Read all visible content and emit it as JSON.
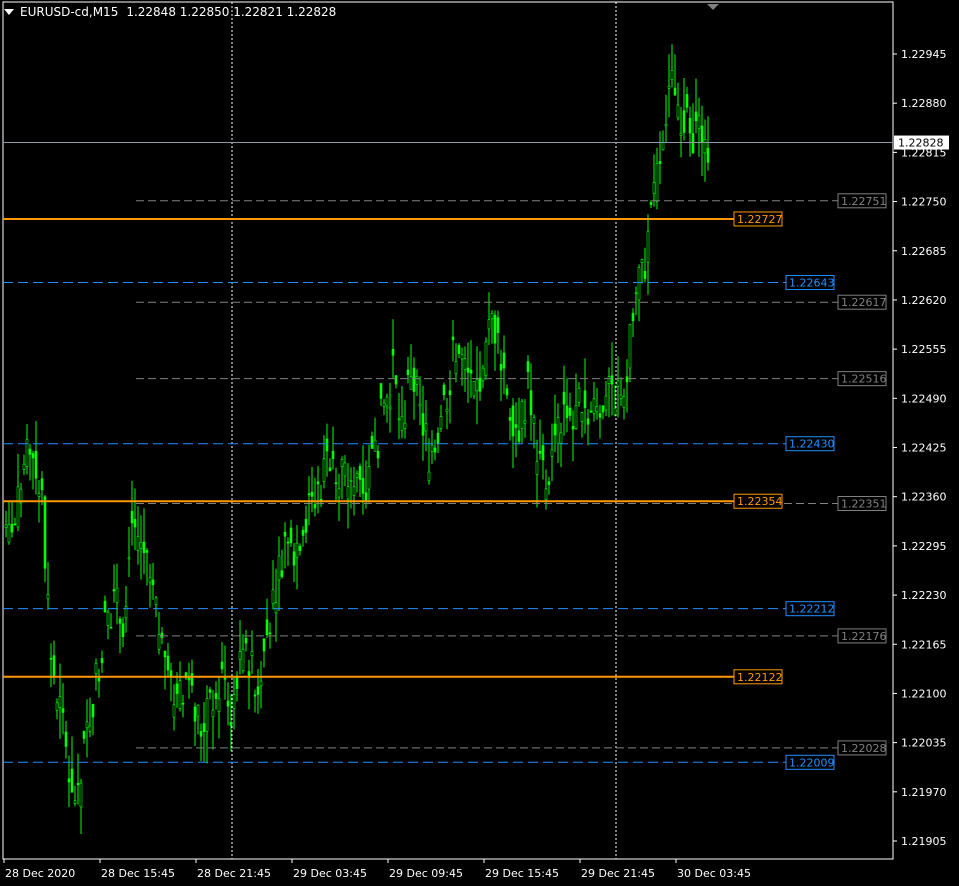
{
  "chart_header": {
    "symbol_timeframe": "EURUSD-cd,M15",
    "ohlc": "1.22848 1.22850 1.22821 1.22828"
  },
  "colors": {
    "background": "#000000",
    "candle": "#00ff00",
    "axis": "#ffffff",
    "grid": "#c0c0c0",
    "orange_level": "#ff9900",
    "blue_level": "#1e90ff",
    "gray_level": "#808080",
    "price_line": "#8a9aa8"
  },
  "chart_data": {
    "type": "candlestick",
    "ylim": [
      1.2188,
      1.23
    ],
    "y_ticks": [
      "1.22945",
      "1.22880",
      "1.22815",
      "1.22750",
      "1.22685",
      "1.22620",
      "1.22555",
      "1.22490",
      "1.22425",
      "1.22360",
      "1.22295",
      "1.22230",
      "1.22165",
      "1.22100",
      "1.22035",
      "1.21970",
      "1.21905"
    ],
    "x_ticks": [
      "28 Dec 2020",
      "28 Dec 15:45",
      "28 Dec 21:45",
      "29 Dec 03:45",
      "29 Dec 09:45",
      "29 Dec 15:45",
      "29 Dec 21:45",
      "30 Dec 03:45"
    ],
    "current_price": "1.22828",
    "orange_levels": [
      "1.22727",
      "1.22354",
      "1.22122"
    ],
    "blue_levels": [
      "1.22643",
      "1.22430",
      "1.22212",
      "1.22009"
    ],
    "gray_levels": [
      "1.22751",
      "1.22617",
      "1.22516",
      "1.22351",
      "1.22176",
      "1.22028"
    ],
    "close_series": [
      1.223,
      1.2232,
      1.224,
      1.2242,
      1.2236,
      1.2215,
      1.2208,
      1.22,
      1.2195,
      1.2205,
      1.2212,
      1.2219,
      1.2222,
      1.222,
      1.2233,
      1.223,
      1.2225,
      1.2218,
      1.2213,
      1.2208,
      1.2212,
      1.2207,
      1.2205,
      1.221,
      1.2212,
      1.2208,
      1.2213,
      1.2215,
      1.2211,
      1.2218,
      1.2225,
      1.223,
      1.2228,
      1.2233,
      1.2235,
      1.2238,
      1.2242,
      1.224,
      1.2238,
      1.224,
      1.2237,
      1.2242,
      1.2248,
      1.2252,
      1.2245,
      1.2253,
      1.2247,
      1.2242,
      1.2245,
      1.225,
      1.2256,
      1.2253,
      1.225,
      1.2252,
      1.226,
      1.2255,
      1.2248,
      1.2245,
      1.225,
      1.2242,
      1.2238,
      1.2243,
      1.2248,
      1.2245,
      1.225,
      1.2247,
      1.2248,
      1.2252,
      1.2249,
      1.2253,
      1.2262,
      1.2267,
      1.2275,
      1.2285,
      1.229,
      1.2287,
      1.2284,
      1.2285,
      1.2283
    ]
  }
}
